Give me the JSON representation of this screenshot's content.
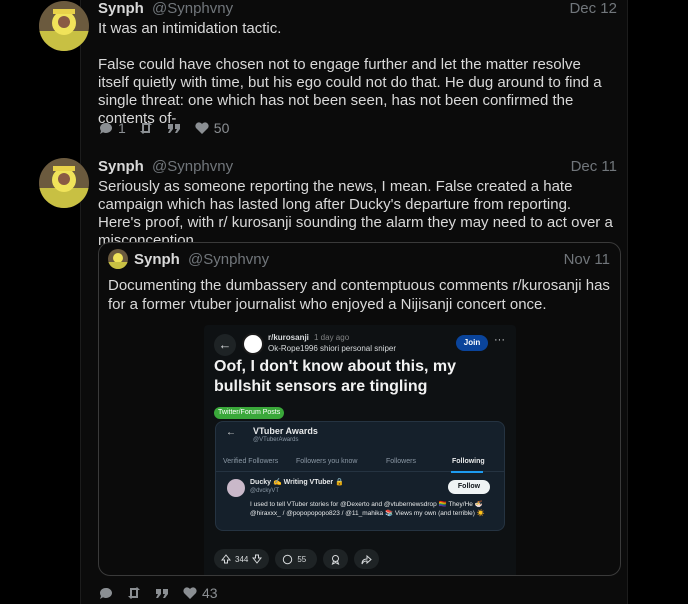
{
  "posts": [
    {
      "name": "Synph",
      "handle": "@Synphvny",
      "date": "Dec 12",
      "paragraphs": [
        "It was an intimidation tactic.",
        "False could have chosen not to engage further and let the matter resolve itself quietly with time, but his ego could not do that. He dug around to find a single threat: one which has not been seen, has not been confirmed the contents of-"
      ],
      "replies": "1",
      "likes": "50"
    },
    {
      "name": "Synph",
      "handle": "@Synphvny",
      "date": "Dec 11",
      "text": "Seriously as someone reporting the news, I mean. False created a hate campaign which has lasted long after Ducky's departure from reporting. Here's proof, with r/ kurosanji sounding the alarm they may need to act over a misconception.",
      "likes": "43"
    }
  ],
  "quote": {
    "name": "Synph",
    "handle": "@Synphvny",
    "date": "Nov 11",
    "text": "Documenting the dumbassery and contemptuous comments r/kurosanji has for a former vtuber journalist who enjoyed a Nijisanji concert once."
  },
  "reddit": {
    "subreddit": "r/kurosanji",
    "time": "1 day ago",
    "user": "Ok-Rope1996",
    "flair": "shiori personal sniper",
    "join": "Join",
    "more": "···",
    "title": "Oof, I don't know about this, my bullshit sensors are tingling",
    "tag": "Twitter/Forum Posts",
    "upvotes": "344",
    "comments": "55"
  },
  "embedded_twitter": {
    "title": "VTuber Awards",
    "handle": "@VTuberAwards",
    "tabs": [
      "Verified Followers",
      "Followers you know",
      "Followers",
      "Following"
    ],
    "user_name": "Ducky ✍️ Writing VTuber 🔒",
    "user_handle": "@dvckyVT",
    "follow": "Follow",
    "bio": "I used to tell VTuber stories for @Dexerto and @vtubernewsdrop 🏳️‍🌈 They/He 🍜 @hiraxxx_ / @popopopopo823 / @11_mahika 📚 Views my own (and terrible) ☀️"
  },
  "colors": {
    "accent": "#1d9bf0",
    "join_button": "#0a449b",
    "tag_green": "#3aa83a"
  }
}
